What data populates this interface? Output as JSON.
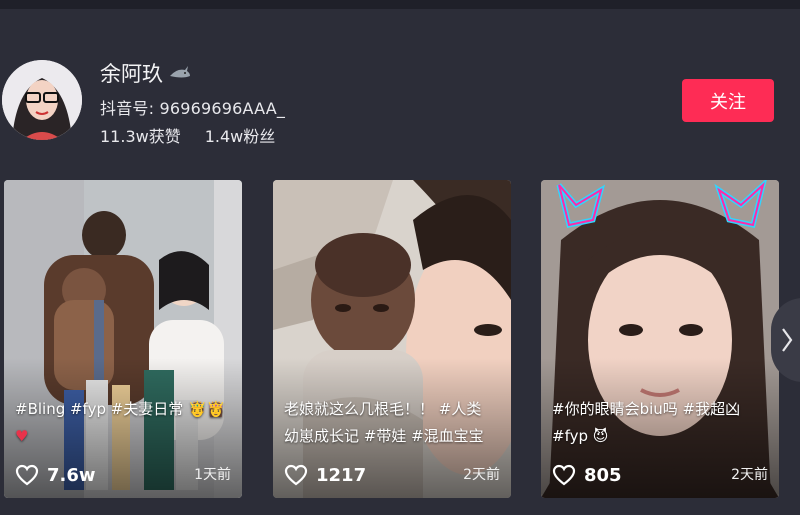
{
  "profile": {
    "name": "余阿玖",
    "id_label": "抖音号: 96969696AAA_",
    "likes": "11.3w获赞",
    "followers": "1.4w粉丝",
    "follow_label": "关注"
  },
  "videos": [
    {
      "caption_line1": "#Bling #fyp #夫妻日常 🤴👸",
      "caption_line2": "♥",
      "likes": "7.6w",
      "time": "1天前"
    },
    {
      "caption_line1": "老娘就这么几根毛！！ #人类",
      "caption_line2": "幼崽成长记 #带娃 #混血宝宝",
      "likes": "1217",
      "time": "2天前"
    },
    {
      "caption_line1": "#你的眼睛会biu吗 #我超凶",
      "caption_line2": "#fyp 😈",
      "likes": "805",
      "time": "2天前"
    }
  ],
  "colors": {
    "accent": "#fe2c55",
    "background": "#2c2d38"
  }
}
